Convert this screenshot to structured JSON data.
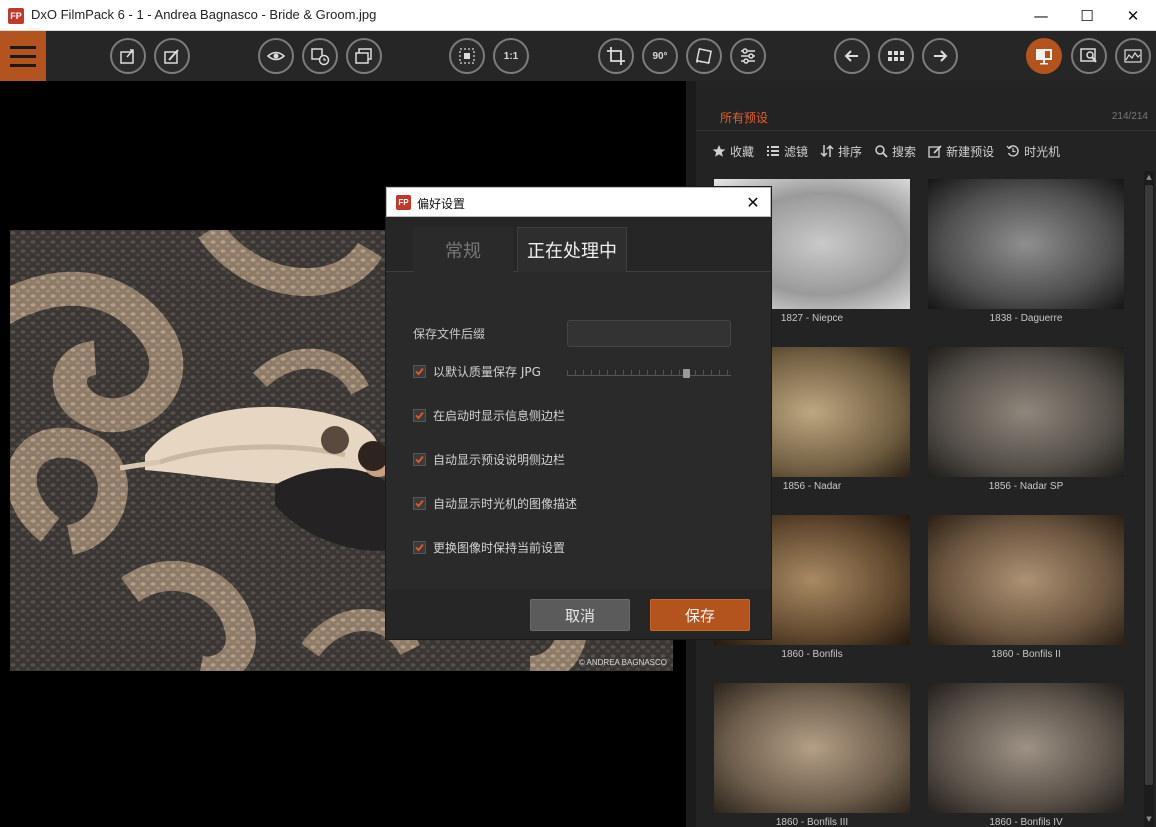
{
  "window": {
    "app_icon": "FP",
    "title": "DxO FilmPack 6 - 1 - Andrea Bagnasco - Bride & Groom.jpg",
    "minimize_glyph": "—",
    "maximize_glyph": "☐",
    "close_glyph": "✕"
  },
  "toolbar": {
    "buttons": [
      {
        "name": "export-to-disk-icon"
      },
      {
        "name": "export-to-application-icon"
      },
      {
        "name": "compare-eye-icon"
      },
      {
        "name": "history-icon"
      },
      {
        "name": "gallery-icon"
      },
      {
        "name": "fit-to-screen-icon"
      },
      {
        "name": "zoom-1-1-label",
        "label": "1:1"
      },
      {
        "name": "crop-icon"
      },
      {
        "name": "rotate-90-icon",
        "label": "90°"
      },
      {
        "name": "straighten-icon"
      },
      {
        "name": "adjustments-icon"
      },
      {
        "name": "previous-image-icon"
      },
      {
        "name": "grid-view-icon"
      },
      {
        "name": "next-image-icon"
      },
      {
        "name": "display-icon"
      },
      {
        "name": "loupe-icon"
      },
      {
        "name": "histogram-icon"
      }
    ]
  },
  "viewer": {
    "credit": "© ANDREA BAGNASCO"
  },
  "presets_panel": {
    "title": "所有预设",
    "count": "214/214",
    "tools": [
      {
        "icon": "star-icon",
        "label": "收藏"
      },
      {
        "icon": "list-icon",
        "label": "滤镜"
      },
      {
        "icon": "sort-icon",
        "label": "排序"
      },
      {
        "icon": "search-icon",
        "label": "搜索"
      },
      {
        "icon": "new-preset-icon",
        "label": "新建预设"
      },
      {
        "icon": "time-machine-icon",
        "label": "时光机"
      }
    ],
    "thumbnails": [
      {
        "label": "1827 - Niepce"
      },
      {
        "label": "1838 - Daguerre"
      },
      {
        "label": "1856 - Nadar"
      },
      {
        "label": "1856 - Nadar SP"
      },
      {
        "label": "1860 - Bonfils"
      },
      {
        "label": "1860 - Bonfils II"
      },
      {
        "label": "1860 - Bonfils III"
      },
      {
        "label": "1860 - Bonfils IV"
      }
    ]
  },
  "preferences_dialog": {
    "icon": "FP",
    "title": "偏好设置",
    "close_glyph": "✕",
    "tabs": [
      {
        "label": "常规",
        "active": false
      },
      {
        "label": "正在处理中",
        "active": true
      }
    ],
    "save_suffix": {
      "label": "保存文件后缀",
      "value": ""
    },
    "jpg_quality": {
      "label": "以默认质量保存 JPG",
      "checked": true,
      "slider_fraction": 0.74
    },
    "options": [
      {
        "label": "在启动时显示信息侧边栏",
        "checked": true
      },
      {
        "label": "自动显示预设说明侧边栏",
        "checked": true
      },
      {
        "label": "自动显示时光机的图像描述",
        "checked": true
      },
      {
        "label": "更换图像时保持当前设置",
        "checked": true
      }
    ],
    "cancel_label": "取消",
    "save_label": "保存"
  },
  "colors": {
    "accent": "#b3541e",
    "panel_title": "#e2602a",
    "checkmark": "#e05a25"
  }
}
